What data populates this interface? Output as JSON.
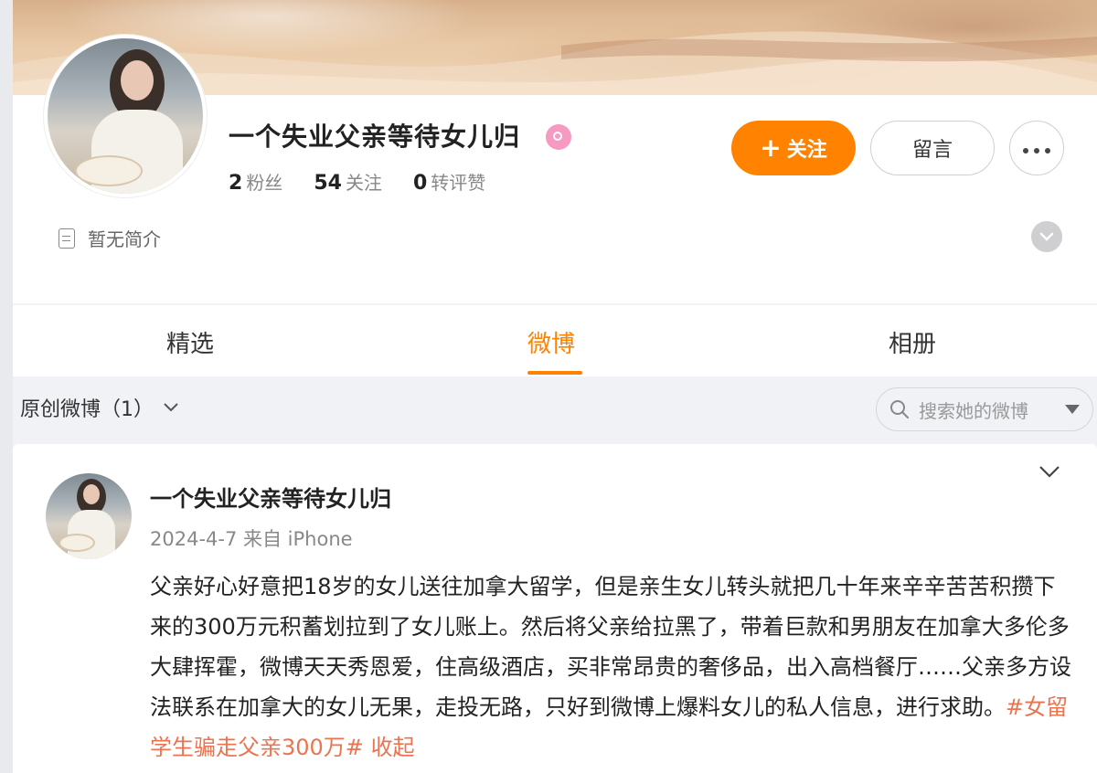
{
  "profile": {
    "name": "一个失业父亲等待女儿归",
    "stats": [
      {
        "value": "2",
        "label": "粉丝"
      },
      {
        "value": "54",
        "label": "关注"
      },
      {
        "value": "0",
        "label": "转评赞"
      }
    ],
    "follow_label": "关注",
    "message_label": "留言",
    "bio": "暂无简介"
  },
  "tabs": [
    {
      "label": "精选"
    },
    {
      "label": "微博"
    },
    {
      "label": "相册"
    }
  ],
  "filter": {
    "label": "原创微博（1）",
    "search_placeholder": "搜索她的微博"
  },
  "post": {
    "author": "一个失业父亲等待女儿归",
    "meta": "2024-4-7  来自 iPhone",
    "text": "父亲好心好意把18岁的女儿送往加拿大留学，但是亲生女儿转头就把几十年来辛辛苦苦积攒下来的300万元积蓄划拉到了女儿账上。然后将父亲给拉黑了，带着巨款和男朋友在加拿大多伦多大肆挥霍，微博天天秀恩爱，住高级酒店，买非常昂贵的奢侈品，出入高档餐厅……父亲多方设法联系在加拿大的女儿无果，走投无路，只好到微博上爆料女儿的私人信息，进行求助。",
    "hashtag": "#女留学生骗走父亲300万#",
    "collapse": "收起"
  },
  "colors": {
    "accent": "#ff8200",
    "link": "#eb7350",
    "verified": "#f69ac1"
  }
}
